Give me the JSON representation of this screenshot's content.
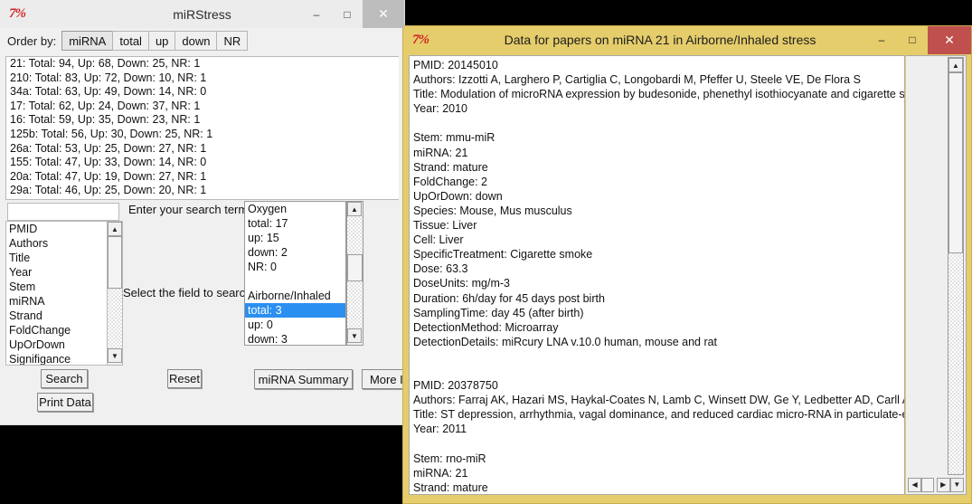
{
  "main_window": {
    "title": "miRStress",
    "logo": "7%",
    "window_controls": {
      "minimize": "–",
      "maximize": "□",
      "close": "✕"
    },
    "toolbar": {
      "order_label": "Order by:",
      "buttons": [
        "miRNA",
        "total",
        "up",
        "down",
        "NR"
      ]
    },
    "mirna_list": [
      "21: Total: 94, Up: 68, Down: 25, NR: 1",
      "210: Total: 83, Up: 72, Down: 10, NR: 1",
      "34a: Total: 63, Up: 49, Down: 14, NR: 0",
      "17: Total: 62, Up: 24, Down: 37, NR: 1",
      "16: Total: 59, Up: 35, Down: 23, NR: 1",
      "125b: Total: 56, Up: 30, Down: 25, NR: 1",
      "26a: Total: 53, Up: 25, Down: 27, NR: 1",
      "155: Total: 47, Up: 33, Down: 14, NR: 0",
      "20a: Total: 47, Up: 19, Down: 27, NR: 1",
      "29a: Total: 46, Up: 25, Down: 20, NR: 1"
    ],
    "search": {
      "value": "",
      "placeholder": ""
    },
    "hints": {
      "search_term": "Enter your search term",
      "select_field": "Select the field to search"
    },
    "field_list": [
      "PMID",
      "Authors",
      "Title",
      "Year",
      "Stem",
      "miRNA",
      "Strand",
      "FoldChange",
      "UpOrDown",
      "Signifigance"
    ],
    "summary_list": [
      {
        "text": "Oxygen",
        "selected": false
      },
      {
        "text": "total: 17",
        "selected": false
      },
      {
        "text": "up: 15",
        "selected": false
      },
      {
        "text": "down: 2",
        "selected": false
      },
      {
        "text": "NR: 0",
        "selected": false
      },
      {
        "text": "",
        "selected": false
      },
      {
        "text": "Airborne/Inhaled",
        "selected": false
      },
      {
        "text": "total: 3",
        "selected": true
      },
      {
        "text": "up: 0",
        "selected": false
      },
      {
        "text": "down: 3",
        "selected": false
      }
    ],
    "buttons": {
      "search": "Search",
      "print_data": "Print Data",
      "reset": "Reset",
      "mirna_summary": "miRNA Summary",
      "more_info": "More In"
    }
  },
  "data_window": {
    "title": "Data for papers on miRNA 21 in Airborne/Inhaled stress",
    "logo": "7%",
    "window_controls": {
      "minimize": "–",
      "maximize": "□",
      "close": "✕"
    },
    "lines": [
      "PMID: 20145010",
      "Authors: Izzotti A, Larghero P, Cartiglia C, Longobardi M, Pfeffer U, Steele VE, De Flora S",
      "Title: Modulation of microRNA expression by budesonide, phenethyl isothiocyanate and cigarette smo",
      "Year: 2010",
      "",
      "Stem: mmu-miR",
      "miRNA: 21",
      "Strand: mature",
      "FoldChange: 2",
      "UpOrDown: down",
      "Species: Mouse, Mus musculus",
      "Tissue: Liver",
      "Cell: Liver",
      "SpecificTreatment: Cigarette smoke",
      "Dose: 63.3",
      "DoseUnits: mg/m-3",
      "Duration: 6h/day for 45 days post birth",
      "SamplingTime: day 45 (after birth)",
      "DetectionMethod: Microarray",
      "DetectionDetails: miRcury LNA v.10.0 human, mouse and rat",
      "",
      "",
      "PMID: 20378750",
      "Authors: Farraj AK,  Hazari MS,  Haykal-Coates N,  Lamb C,  Winsett DW,  Ge Y,  Ledbetter AD,  Carll AP,",
      "Title: ST depression, arrhythmia, vagal dominance, and reduced cardiac micro-RNA in particulate-expo",
      "Year: 2011",
      "",
      "Stem: rno-miR",
      "miRNA: 21",
      "Strand: mature"
    ],
    "scroll": {
      "up_arrow": "▲",
      "down_arrow": "▼",
      "left_arrow": "◀",
      "right_arrow": "▶"
    }
  },
  "colors": {
    "data_window_frame": "#e5cd6b",
    "close_active": "#c0504d",
    "selection": "#2a8ff0",
    "logo_red": "#d02020",
    "desktop": "#000000"
  }
}
